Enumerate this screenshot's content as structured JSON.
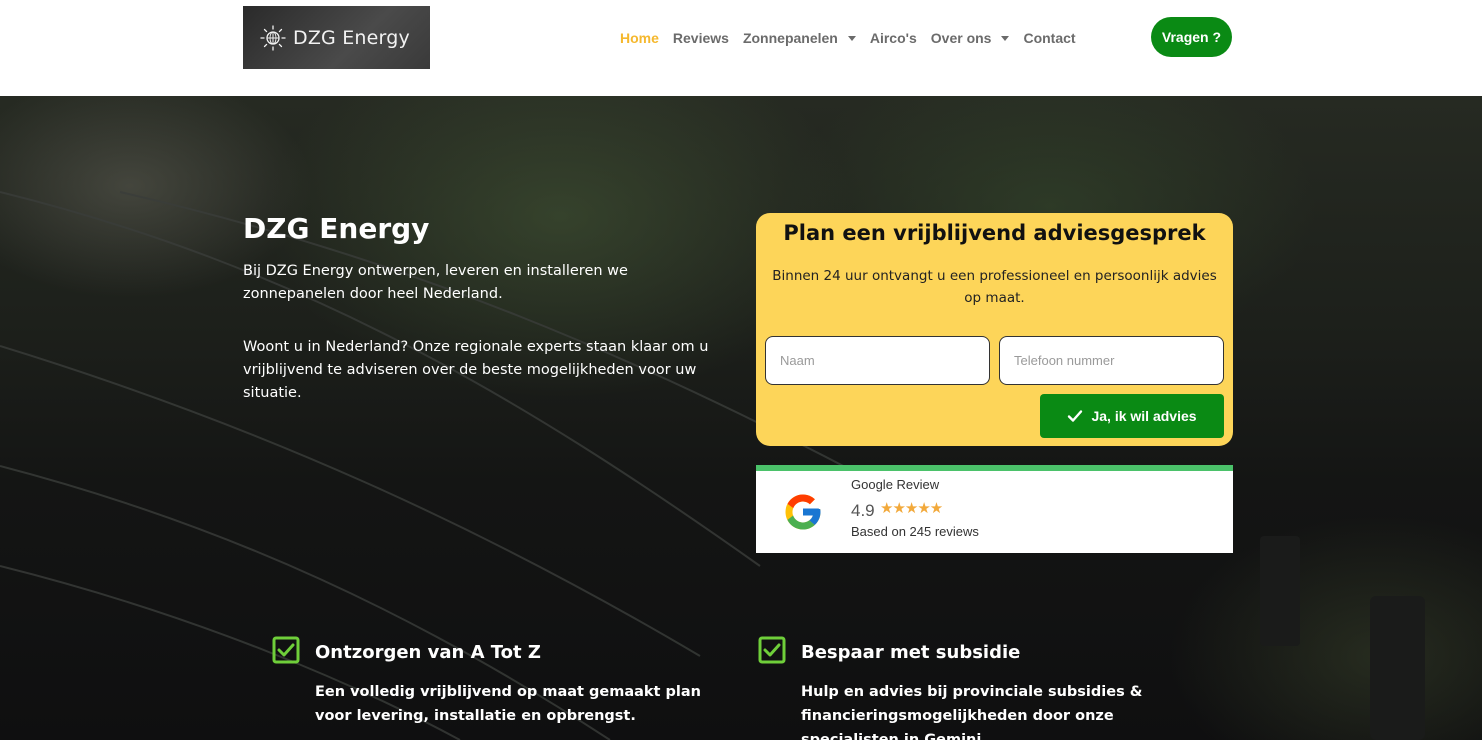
{
  "header": {
    "logo_text": "DZG Energy",
    "nav": [
      {
        "label": "Home",
        "active": true,
        "dropdown": false
      },
      {
        "label": "Reviews",
        "active": false,
        "dropdown": false
      },
      {
        "label": "Zonnepanelen",
        "active": false,
        "dropdown": true
      },
      {
        "label": "Airco's",
        "active": false,
        "dropdown": false
      },
      {
        "label": "Over ons",
        "active": false,
        "dropdown": true
      },
      {
        "label": "Contact",
        "active": false,
        "dropdown": false
      }
    ],
    "cta_label": "Vragen ?"
  },
  "hero": {
    "title": "DZG Energy",
    "paragraph1": "Bij DZG Energy ontwerpen, leveren en installeren we zonnepanelen door heel Nederland.",
    "paragraph2": "Woont u in Nederland? Onze regionale experts staan klaar om u vrijblijvend te adviseren over de beste mogelijkheden voor uw situatie."
  },
  "form": {
    "title": "Plan een vrijblijvend adviesgesprek",
    "subtitle": "Binnen 24 uur ontvangt u een professioneel en persoonlijk advies op maat.",
    "name_placeholder": "Naam",
    "phone_placeholder": "Telefoon nummer",
    "submit_label": "Ja, ik wil advies"
  },
  "review": {
    "title": "Google Review",
    "score": "4.9",
    "stars": "★★★★★",
    "count_text": "Based on 245 reviews"
  },
  "features": [
    {
      "title": "Ontzorgen van A Tot Z",
      "text": "Een volledig vrijblijvend op maat gemaakt plan voor levering, installatie en opbrengst."
    },
    {
      "title": "Bespaar met subsidie",
      "text": "Hulp en advies bij provinciale subsidies & financieringsmogelijkheden door onze specialisten in Gemini."
    }
  ],
  "colors": {
    "accent_green": "#0a8a14",
    "form_yellow": "#fdd559",
    "nav_active": "#f5b82e",
    "check_green": "#6fcf3a"
  }
}
